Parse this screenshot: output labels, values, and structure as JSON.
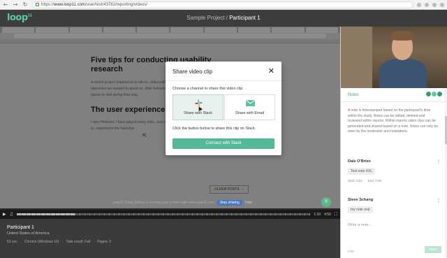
{
  "browser": {
    "url_prefix": "https://",
    "url_host": "www.loop11.com",
    "url_path": "/user/test/43782/reporting/videos/"
  },
  "app": {
    "logo": "loop",
    "logo_mark": "11",
    "project": "Sample Project",
    "separator": " / ",
    "participant_title": "Participant 1"
  },
  "recorded_page": {
    "heading1": "Five tips for conducting usability research",
    "para1": "A recent project required us to talk to...impossible to recruit through a qualified...client's objectives we needed to speak to...their behaviours, motivations and influences...and places to visit during their stay.",
    "heading2": "The user experience",
    "para2": "I own Pinterest. I have played every intro...and collected all the cards. So I am all in...experience the franchise.",
    "older_posts": "OLDER POSTS →",
    "notice_text": "Loop11 Video Setting is sharing your screen with www.loop11.com",
    "notice_stop": "Stop sharing",
    "notice_hide": "Hide"
  },
  "player": {
    "elapsed": "1:10",
    "duration": "4:50",
    "progress": 0.2,
    "badge": "II"
  },
  "modal": {
    "title": "Share video clip",
    "close": "✕",
    "subtitle": "Choose a channel to share this video clip",
    "option_slack": "Share with Slack",
    "option_email": "Share with Email",
    "note": "Click the button below to share this clip on Slack.",
    "connect_button": "Connect with Slack"
  },
  "participant": {
    "name": "Participant 1",
    "country": "United States of America",
    "duration": "53 sec",
    "browser": "Chrome (Windows 10)",
    "task_result": "Task result: Fail",
    "pages": "Pages: 3"
  },
  "notes": {
    "title": "Notes",
    "intro": "A note is timestamped based on the participant's time within the study. Notes can be edited, deleted and reviewed within reports. Within reports video clips can be generated and shared based on a note. Notes can only be seen by the moderator and notetakers.",
    "items": [
      {
        "author": "Dale O'Brien",
        "more": "⋮",
        "text": "Test note XXL",
        "start": "Start: 0:01",
        "end": "End: 0:05"
      },
      {
        "author": "Steve Schang",
        "more": "⋮",
        "text": "my note one",
        "start": "",
        "end": ""
      }
    ],
    "input_placeholder": "Write a note...",
    "footer_time": "0:00",
    "save_label": "Save"
  },
  "colors": {
    "accent": "#54b894",
    "header_bg": "#3d3d3d"
  }
}
